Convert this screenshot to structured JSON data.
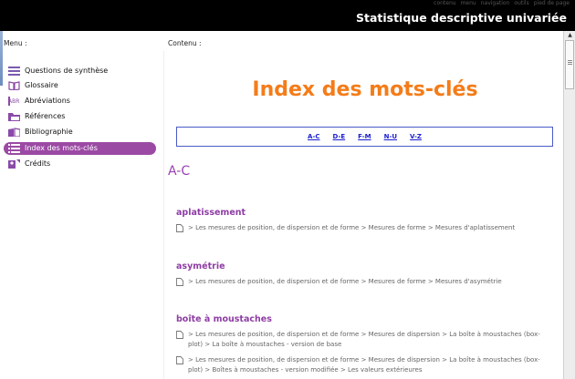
{
  "topbar": {
    "links": [
      "contenu",
      "menu",
      "navigation",
      "outils",
      "pied de page"
    ],
    "title": "Statistique descriptive univariée"
  },
  "menu": {
    "heading": "Menu :",
    "items": [
      {
        "label": "Questions de synthèse",
        "icon": "list-lines-icon"
      },
      {
        "label": "Glossaire",
        "icon": "book-icon"
      },
      {
        "label": "Abréviations",
        "icon": "abbreviation-icon"
      },
      {
        "label": "Références",
        "icon": "folder-icon"
      },
      {
        "label": "Bibliographie",
        "icon": "books-icon"
      },
      {
        "label": "Index des mots-clés",
        "icon": "index-icon",
        "active": true
      },
      {
        "label": "Crédits",
        "icon": "credits-icon"
      }
    ]
  },
  "content": {
    "heading": "Contenu :",
    "title": "Index des mots-clés",
    "letters": [
      "A-C",
      "D-E",
      "F-M",
      "N-U",
      "V-Z"
    ],
    "section": "A-C",
    "entries": [
      {
        "title": "aplatissement",
        "paths": [
          "> Les mesures de position, de dispersion et de forme > Mesures de forme > Mesures d'aplatissement"
        ]
      },
      {
        "title": "asymétrie",
        "paths": [
          "> Les mesures de position, de dispersion et de forme > Mesures de forme > Mesures d'asymétrie"
        ]
      },
      {
        "title": "boîte à moustaches",
        "paths": [
          "> Les mesures de position, de dispersion et de forme > Mesures de dispersion > La boîte à moustaches (box-plot) > La boîte à moustaches - version de base",
          "> Les mesures de position, de dispersion et de forme > Mesures de dispersion > La boîte à moustaches (box-plot) > Boîtes à moustaches - version modifiée > Les valeurs extérieures"
        ]
      }
    ]
  },
  "colors": {
    "accent": "#f47c19",
    "menu_active": "#9b4aa4",
    "link": "#1b1fcf",
    "entry": "#8e3da5"
  }
}
